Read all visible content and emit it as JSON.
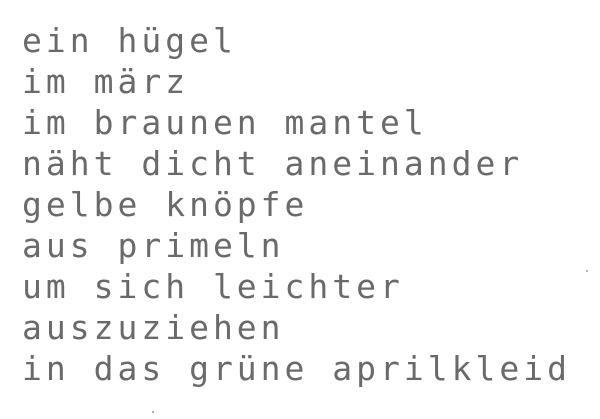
{
  "poem": {
    "lines": [
      "ein hügel",
      "im märz",
      "im braunen mantel",
      "näht dicht aneinander",
      "gelbe knöpfe",
      "aus primeln",
      "um sich leichter",
      "auszuziehen",
      "in das grüne aprilkleid"
    ]
  }
}
